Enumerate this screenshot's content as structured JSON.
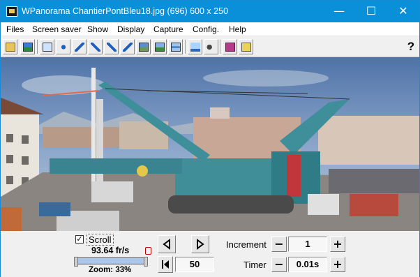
{
  "window": {
    "title": "WPanorama  ChantierPontBleu18.jpg  (696) 600 x 250",
    "minimize_glyph": "—",
    "maximize_glyph": "☐",
    "close_glyph": "✕"
  },
  "menu": {
    "items": [
      "Files",
      "Screen saver",
      "Show",
      "Display",
      "Capture",
      "Config.",
      "Help"
    ]
  },
  "toolbar": {
    "buttons": [
      "open-file-icon",
      "picture-icon",
      "select-region-icon",
      "move-arrows-icon",
      "scroll-left-icon",
      "scroll-up-right-icon",
      "scroll-down-left-icon",
      "scroll-right-icon",
      "panorama-view-icon",
      "landscape-icon",
      "flat-view-icon",
      "sound-level-icon",
      "speaker-icon",
      "book-icon",
      "help-book-icon"
    ],
    "help_glyph": "?"
  },
  "image": {
    "file": "ChantierPontBleu18.jpg",
    "description_icon": "panorama-image"
  },
  "controls": {
    "scroll_checked": true,
    "scroll_label": "Scroll",
    "fps": "93.64 fr/s",
    "zoom": "Zoom: 33%",
    "zoom_fraction": 0.33,
    "position_value": "50",
    "increment_label": "Increment",
    "increment_value": "1",
    "timer_label": "Timer",
    "timer_value": "0.01s",
    "minus_glyph": "−",
    "plus_glyph": "+"
  },
  "colors": {
    "titlebar": "#0a8fd9",
    "crane": "#3e8f9a",
    "sky": "#6e8bb3"
  }
}
